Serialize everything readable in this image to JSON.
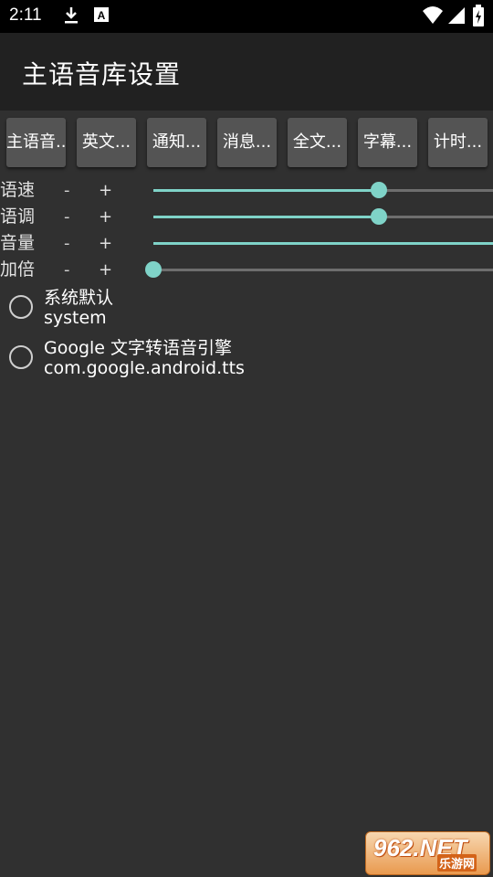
{
  "status_bar": {
    "time": "2:11",
    "icons": [
      "download-icon",
      "a-notification-icon",
      "wifi-icon",
      "signal-icon",
      "battery-icon"
    ]
  },
  "app_bar": {
    "title": "主语音库设置"
  },
  "tabs": [
    {
      "label": "主语音..."
    },
    {
      "label": "英文..."
    },
    {
      "label": "通知..."
    },
    {
      "label": "消息..."
    },
    {
      "label": "全文..."
    },
    {
      "label": "字幕..."
    },
    {
      "label": "计时..."
    }
  ],
  "controls": {
    "minus_label": "-",
    "plus_label": "+",
    "sliders": [
      {
        "label": "语速",
        "value": 0.665
      },
      {
        "label": "语调",
        "value": 0.665
      },
      {
        "label": "音量",
        "value": 1.0
      },
      {
        "label": "加倍",
        "value": 0.0
      }
    ]
  },
  "engines": [
    {
      "title": "系统默认",
      "subtitle": "system",
      "selected": false
    },
    {
      "title": "Google 文字转语音引擎",
      "subtitle": "com.google.android.tts",
      "selected": false
    }
  ],
  "watermark": {
    "logo": "962.NET",
    "sub": "乐游网"
  },
  "colors": {
    "accent": "#7fd3c8",
    "background": "#303030",
    "app_bar": "#212121",
    "button": "#545454"
  }
}
